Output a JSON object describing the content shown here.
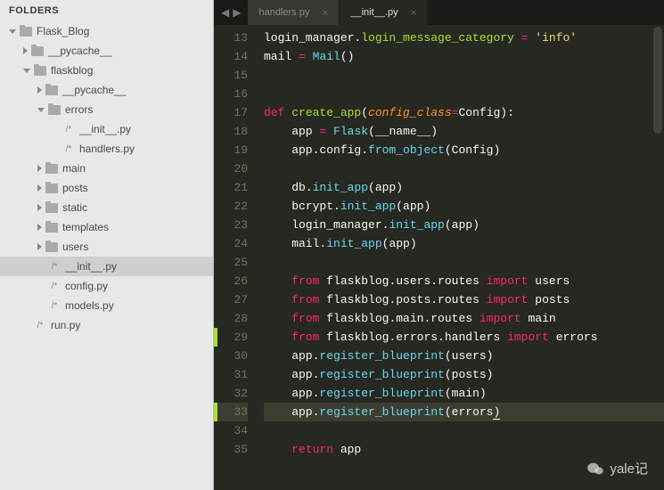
{
  "sidebar": {
    "title": "FOLDERS",
    "tree": [
      {
        "depth": 0,
        "kind": "folder",
        "open": true,
        "label": "Flask_Blog"
      },
      {
        "depth": 1,
        "kind": "folder",
        "open": false,
        "label": "__pycache__"
      },
      {
        "depth": 1,
        "kind": "folder",
        "open": true,
        "label": "flaskblog"
      },
      {
        "depth": 2,
        "kind": "folder",
        "open": false,
        "label": "__pycache__"
      },
      {
        "depth": 2,
        "kind": "folder",
        "open": true,
        "label": "errors"
      },
      {
        "depth": 3,
        "kind": "file",
        "label": "__init__.py"
      },
      {
        "depth": 3,
        "kind": "file",
        "label": "handlers.py"
      },
      {
        "depth": 2,
        "kind": "folder",
        "open": false,
        "label": "main"
      },
      {
        "depth": 2,
        "kind": "folder",
        "open": false,
        "label": "posts"
      },
      {
        "depth": 2,
        "kind": "folder",
        "open": false,
        "label": "static"
      },
      {
        "depth": 2,
        "kind": "folder",
        "open": false,
        "label": "templates"
      },
      {
        "depth": 2,
        "kind": "folder",
        "open": false,
        "label": "users"
      },
      {
        "depth": 2,
        "kind": "file",
        "label": "__init__.py",
        "selected": true
      },
      {
        "depth": 2,
        "kind": "file",
        "label": "config.py"
      },
      {
        "depth": 2,
        "kind": "file",
        "label": "models.py"
      },
      {
        "depth": 1,
        "kind": "file",
        "label": "run.py"
      }
    ]
  },
  "tabs": {
    "items": [
      {
        "label": "handlers.py",
        "active": false
      },
      {
        "label": "__init__.py",
        "active": true
      }
    ]
  },
  "editor": {
    "first_line_number": 13,
    "cursor_line_number": 33,
    "marked_lines": [
      29,
      33
    ],
    "lines": [
      [
        [
          "pln",
          "login_manager."
        ],
        [
          "nm",
          "login_message_category"
        ],
        [
          "pln",
          " "
        ],
        [
          "op",
          "="
        ],
        [
          "pln",
          " "
        ],
        [
          "str",
          "'info'"
        ]
      ],
      [
        [
          "pln",
          "mail "
        ],
        [
          "op",
          "="
        ],
        [
          "pln",
          " "
        ],
        [
          "call",
          "Mail"
        ],
        [
          "pln",
          "()"
        ]
      ],
      [],
      [],
      [
        [
          "kw",
          "def"
        ],
        [
          "pln",
          " "
        ],
        [
          "nm",
          "create_app"
        ],
        [
          "pln",
          "("
        ],
        [
          "prm",
          "config_class"
        ],
        [
          "op",
          "="
        ],
        [
          "pln",
          "Config):"
        ]
      ],
      [
        [
          "pln",
          "    app "
        ],
        [
          "op",
          "="
        ],
        [
          "pln",
          " "
        ],
        [
          "call",
          "Flask"
        ],
        [
          "pln",
          "(__name__)"
        ]
      ],
      [
        [
          "pln",
          "    app.config."
        ],
        [
          "call",
          "from_object"
        ],
        [
          "pln",
          "(Config)"
        ]
      ],
      [],
      [
        [
          "pln",
          "    db."
        ],
        [
          "call",
          "init_app"
        ],
        [
          "pln",
          "(app)"
        ]
      ],
      [
        [
          "pln",
          "    bcrypt."
        ],
        [
          "call",
          "init_app"
        ],
        [
          "pln",
          "(app)"
        ]
      ],
      [
        [
          "pln",
          "    login_manager."
        ],
        [
          "call",
          "init_app"
        ],
        [
          "pln",
          "(app)"
        ]
      ],
      [
        [
          "pln",
          "    mail."
        ],
        [
          "call",
          "init_app"
        ],
        [
          "pln",
          "(app)"
        ]
      ],
      [],
      [
        [
          "pln",
          "    "
        ],
        [
          "kw",
          "from"
        ],
        [
          "pln",
          " flaskblog.users.routes "
        ],
        [
          "kw",
          "import"
        ],
        [
          "pln",
          " users"
        ]
      ],
      [
        [
          "pln",
          "    "
        ],
        [
          "kw",
          "from"
        ],
        [
          "pln",
          " flaskblog.posts.routes "
        ],
        [
          "kw",
          "import"
        ],
        [
          "pln",
          " posts"
        ]
      ],
      [
        [
          "pln",
          "    "
        ],
        [
          "kw",
          "from"
        ],
        [
          "pln",
          " flaskblog.main.routes "
        ],
        [
          "kw",
          "import"
        ],
        [
          "pln",
          " main"
        ]
      ],
      [
        [
          "pln",
          "    "
        ],
        [
          "kw",
          "from"
        ],
        [
          "pln",
          " flaskblog.errors.handlers "
        ],
        [
          "kw",
          "import"
        ],
        [
          "pln",
          " errors"
        ]
      ],
      [
        [
          "pln",
          "    app."
        ],
        [
          "call",
          "register_blueprint"
        ],
        [
          "pln",
          "(users)"
        ]
      ],
      [
        [
          "pln",
          "    app."
        ],
        [
          "call",
          "register_blueprint"
        ],
        [
          "pln",
          "(posts)"
        ]
      ],
      [
        [
          "pln",
          "    app."
        ],
        [
          "call",
          "register_blueprint"
        ],
        [
          "pln",
          "(main)"
        ]
      ],
      [
        [
          "pln",
          "    app."
        ],
        [
          "call",
          "register_blueprint"
        ],
        [
          "pln",
          "(errors"
        ],
        [
          "cursor",
          ")"
        ]
      ],
      [],
      [
        [
          "pln",
          "    "
        ],
        [
          "kw",
          "return"
        ],
        [
          "pln",
          " app"
        ]
      ]
    ]
  },
  "watermark": {
    "text": "yale记"
  }
}
